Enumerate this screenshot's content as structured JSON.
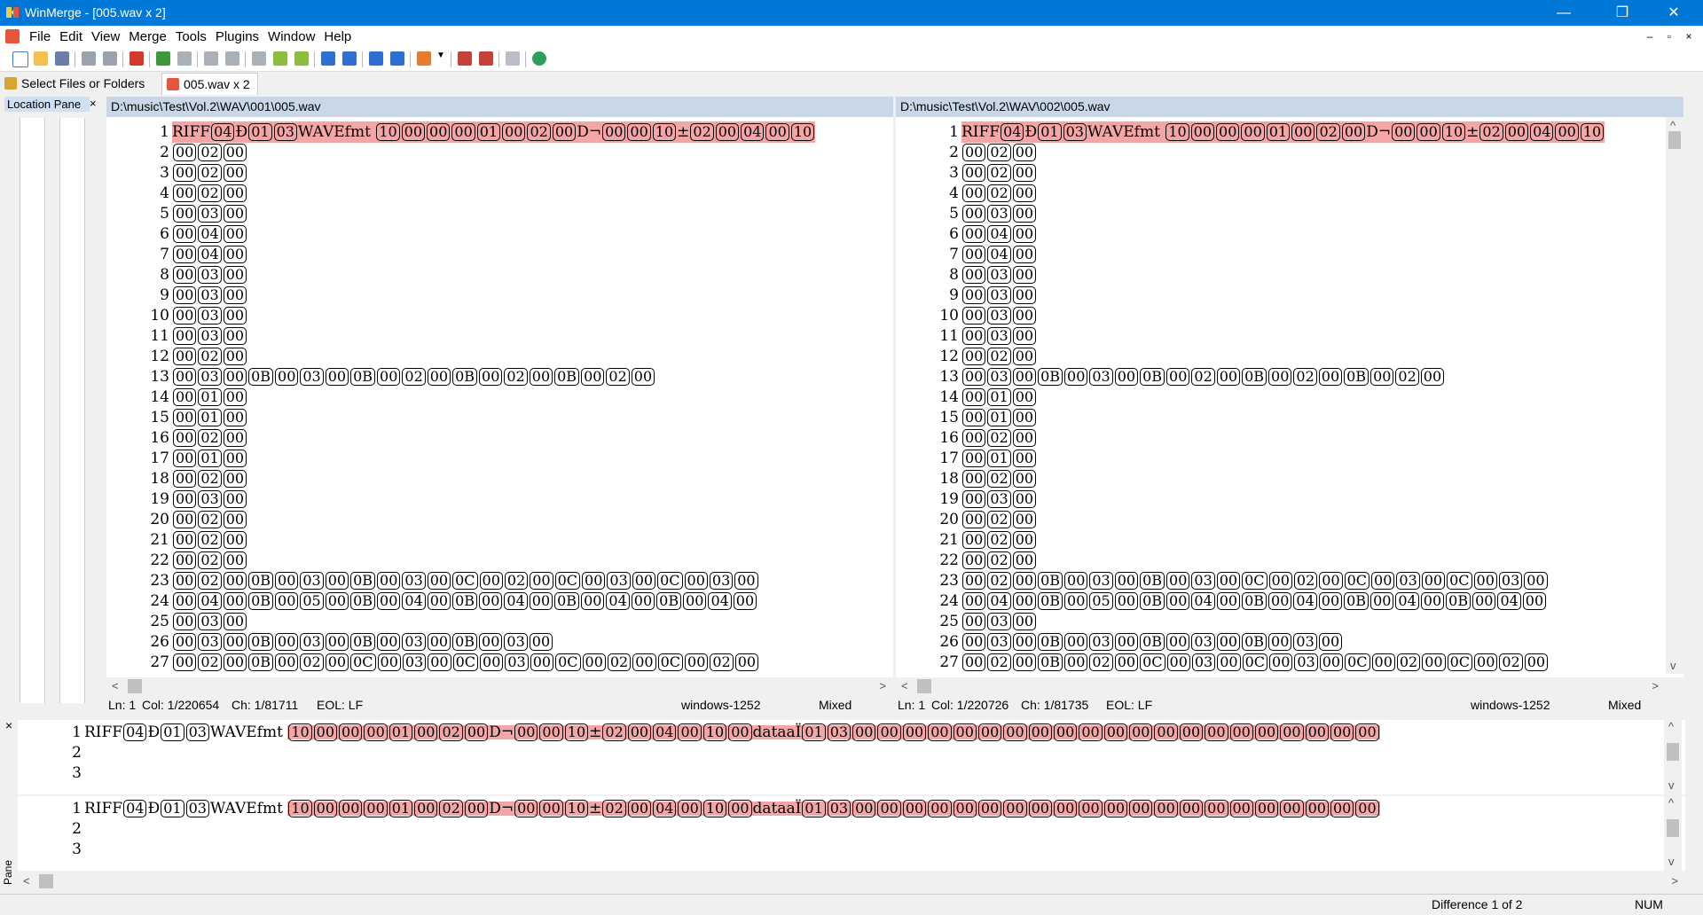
{
  "window": {
    "title": "WinMerge - [005.wav x 2]",
    "minimize": "—",
    "restore": "❐",
    "close": "✕"
  },
  "menu": [
    "File",
    "Edit",
    "View",
    "Merge",
    "Tools",
    "Plugins",
    "Window",
    "Help"
  ],
  "mdi": {
    "minimize": "–",
    "restore": "▫",
    "close": "×"
  },
  "tabs": [
    {
      "label": "Select Files or Folders",
      "icon": "folder-compare-icon"
    },
    {
      "label": "005.wav x 2",
      "icon": "winmerge-doc-icon"
    }
  ],
  "location_pane": {
    "title": "Location Pane",
    "close": "×"
  },
  "left": {
    "path": "D:\\music\\Test\\Vol.2\\WAV\\001\\005.wav",
    "status": {
      "ln": "Ln: 1",
      "col": "Col: 1/220654",
      "ch": "Ch: 1/81711",
      "eol": "EOL: LF",
      "enc": "windows-1252",
      "mode": "Mixed"
    }
  },
  "right": {
    "path": "D:\\music\\Test\\Vol.2\\WAV\\002\\005.wav",
    "status": {
      "ln": "Ln: 1",
      "col": "Col: 1/220726",
      "ch": "Ch: 1/81735",
      "eol": "EOL: LF",
      "enc": "windows-1252",
      "mode": "Mixed"
    }
  },
  "lines": [
    {
      "n": "1",
      "diff": true,
      "toks": [
        "RIFF",
        "[04]",
        "Ð",
        "[01]",
        "[03]",
        "WAVEfmt ",
        "[10]",
        "[00]",
        "[00]",
        "[00]",
        "[01]",
        "[00]",
        "[02]",
        "[00]",
        "D¬",
        "[00]",
        "[00]",
        "[10]",
        "±",
        "[02]",
        "[00]",
        "[04]",
        "[00]",
        "[10]"
      ]
    },
    {
      "n": "2",
      "toks": [
        "[00]",
        "[02]",
        "[00]"
      ]
    },
    {
      "n": "3",
      "toks": [
        "[00]",
        "[02]",
        "[00]"
      ]
    },
    {
      "n": "4",
      "toks": [
        "[00]",
        "[02]",
        "[00]"
      ]
    },
    {
      "n": "5",
      "toks": [
        "[00]",
        "[03]",
        "[00]"
      ]
    },
    {
      "n": "6",
      "toks": [
        "[00]",
        "[04]",
        "[00]"
      ]
    },
    {
      "n": "7",
      "toks": [
        "[00]",
        "[04]",
        "[00]"
      ]
    },
    {
      "n": "8",
      "toks": [
        "[00]",
        "[03]",
        "[00]"
      ]
    },
    {
      "n": "9",
      "toks": [
        "[00]",
        "[03]",
        "[00]"
      ]
    },
    {
      "n": "10",
      "toks": [
        "[00]",
        "[03]",
        "[00]"
      ]
    },
    {
      "n": "11",
      "toks": [
        "[00]",
        "[03]",
        "[00]"
      ]
    },
    {
      "n": "12",
      "toks": [
        "[00]",
        "[02]",
        "[00]"
      ]
    },
    {
      "n": "13",
      "toks": [
        "[00]",
        "[03]",
        "[00]",
        "[0B]",
        "[00]",
        "[03]",
        "[00]",
        "[0B]",
        "[00]",
        "[02]",
        "[00]",
        "[0B]",
        "[00]",
        "[02]",
        "[00]",
        "[0B]",
        "[00]",
        "[02]",
        "[00]"
      ]
    },
    {
      "n": "14",
      "toks": [
        "[00]",
        "[01]",
        "[00]"
      ]
    },
    {
      "n": "15",
      "toks": [
        "[00]",
        "[01]",
        "[00]"
      ]
    },
    {
      "n": "16",
      "toks": [
        "[00]",
        "[02]",
        "[00]"
      ]
    },
    {
      "n": "17",
      "toks": [
        "[00]",
        "[01]",
        "[00]"
      ]
    },
    {
      "n": "18",
      "toks": [
        "[00]",
        "[02]",
        "[00]"
      ]
    },
    {
      "n": "19",
      "toks": [
        "[00]",
        "[03]",
        "[00]"
      ]
    },
    {
      "n": "20",
      "toks": [
        "[00]",
        "[02]",
        "[00]"
      ]
    },
    {
      "n": "21",
      "toks": [
        "[00]",
        "[02]",
        "[00]"
      ]
    },
    {
      "n": "22",
      "toks": [
        "[00]",
        "[02]",
        "[00]"
      ]
    },
    {
      "n": "23",
      "toks": [
        "[00]",
        "[02]",
        "[00]",
        "[0B]",
        "[00]",
        "[03]",
        "[00]",
        "[0B]",
        "[00]",
        "[03]",
        "[00]",
        "[0C]",
        "[00]",
        "[02]",
        "[00]",
        "[0C]",
        "[00]",
        "[03]",
        "[00]",
        "[0C]",
        "[00]",
        "[03]",
        "[00]"
      ]
    },
    {
      "n": "24",
      "toks": [
        "[00]",
        "[04]",
        "[00]",
        "[0B]",
        "[00]",
        "[05]",
        "[00]",
        "[0B]",
        "[00]",
        "[04]",
        "[00]",
        "[0B]",
        "[00]",
        "[04]",
        "[00]",
        "[0B]",
        "[00]",
        "[04]",
        "[00]",
        "[0B]",
        "[00]",
        "[04]",
        "[00]"
      ]
    },
    {
      "n": "25",
      "toks": [
        "[00]",
        "[03]",
        "[00]"
      ]
    },
    {
      "n": "26",
      "toks": [
        "[00]",
        "[03]",
        "[00]",
        "[0B]",
        "[00]",
        "[03]",
        "[00]",
        "[0B]",
        "[00]",
        "[03]",
        "[00]",
        "[0B]",
        "[00]",
        "[03]",
        "[00]"
      ]
    },
    {
      "n": "27",
      "toks": [
        "[00]",
        "[02]",
        "[00]",
        "[0B]",
        "[00]",
        "[02]",
        "[00]",
        "[0C]",
        "[00]",
        "[03]",
        "[00]",
        "[0C]",
        "[00]",
        "[03]",
        "[00]",
        "[0C]",
        "[00]",
        "[02]",
        "[00]",
        "[0C]",
        "[00]",
        "[02]",
        "[00]"
      ]
    }
  ],
  "diffpane": {
    "label": "Diff Pane",
    "close": "×",
    "head": [
      "RIFF",
      "[04]",
      "Ð",
      "[01]",
      "[03]",
      "WAVEfmt "
    ],
    "tail": [
      "[10]",
      "[00]",
      "[00]",
      "[00]",
      "[01]",
      "[00]",
      "[02]",
      "[00]",
      "D¬",
      "[00]",
      "[00]",
      "[10]",
      "±",
      "[02]",
      "[00]",
      "[04]",
      "[00]",
      "[10]",
      "[00]",
      "dataaÏ",
      "[01]",
      "[03]",
      "[00]",
      "[00]",
      "[00]",
      "[00]",
      "[00]",
      "[00]",
      "[00]",
      "[00]",
      "[00]",
      "[00]",
      "[00]",
      "[00]",
      "[00]",
      "[00]",
      "[00]",
      "[00]",
      "[00]",
      "[00]",
      "[00]",
      "[00]",
      "[00]"
    ],
    "nums": [
      "1",
      "2",
      "3"
    ]
  },
  "statusbar": {
    "difference": "Difference 1 of 2",
    "num": "NUM"
  }
}
